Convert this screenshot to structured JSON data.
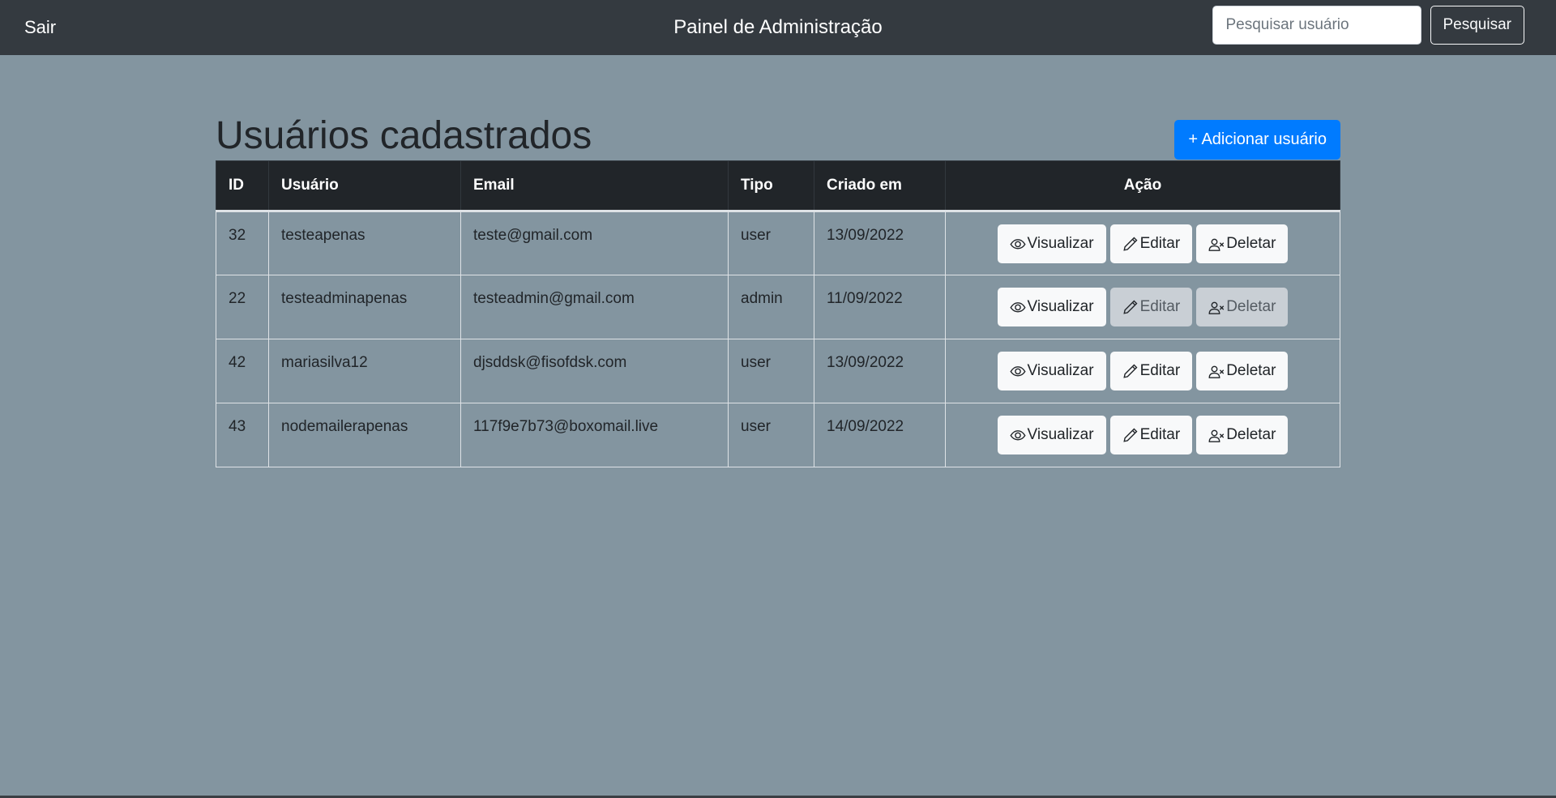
{
  "nav": {
    "logout_label": "Sair",
    "title": "Painel de Administração",
    "search_placeholder": "Pesquisar usuário",
    "search_button": "Pesquisar"
  },
  "page": {
    "title": "Usuários cadastrados",
    "add_button": "+ Adicionar usuário"
  },
  "table": {
    "headers": {
      "id": "ID",
      "user": "Usuário",
      "email": "Email",
      "type": "Tipo",
      "created": "Criado em",
      "action": "Ação"
    },
    "actions": {
      "view": "Visualizar",
      "edit": "Editar",
      "delete": "Deletar"
    },
    "rows": [
      {
        "id": "32",
        "user": "testeapenas",
        "email": "teste@gmail.com",
        "type": "user",
        "created": "13/09/2022",
        "edit_disabled": false,
        "delete_disabled": false
      },
      {
        "id": "22",
        "user": "testeadminapenas",
        "email": "testeadmin@gmail.com",
        "type": "admin",
        "created": "11/09/2022",
        "edit_disabled": true,
        "delete_disabled": true
      },
      {
        "id": "42",
        "user": "mariasilva12",
        "email": "djsddsk@fisofdsk.com",
        "type": "user",
        "created": "13/09/2022",
        "edit_disabled": false,
        "delete_disabled": false
      },
      {
        "id": "43",
        "user": "nodemailerapenas",
        "email": "117f9e7b73@boxomail.live",
        "type": "user",
        "created": "14/09/2022",
        "edit_disabled": false,
        "delete_disabled": false
      }
    ]
  },
  "colors": {
    "background": "#8395a0",
    "navbar": "#343a40",
    "table_header": "#212529",
    "primary": "#007bff"
  }
}
